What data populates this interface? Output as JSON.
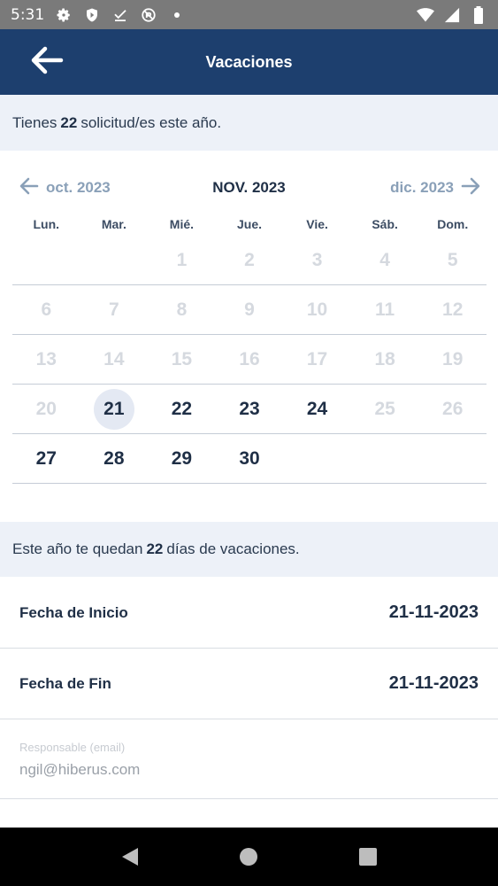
{
  "status_bar": {
    "time": "5:31",
    "icons_left": [
      "settings-icon",
      "shield-play-icon",
      "download-done-icon",
      "no-sim-icon",
      "dot-icon"
    ],
    "icons_right": [
      "wifi-icon",
      "signal-icon",
      "battery-icon"
    ]
  },
  "app_bar": {
    "title": "Vacaciones",
    "background": "#1d3f6e"
  },
  "requests_banner": {
    "prefix": "Tienes",
    "count": "22",
    "suffix": "solicitud/es este año."
  },
  "calendar": {
    "prev_month": "oct. 2023",
    "current_month": "NOV. 2023",
    "next_month": "dic. 2023",
    "weekdays": [
      "Lun.",
      "Mar.",
      "Mié.",
      "Jue.",
      "Vie.",
      "Sáb.",
      "Dom."
    ],
    "weeks": [
      [
        {
          "d": ""
        },
        {
          "d": ""
        },
        {
          "d": "1",
          "s": "disabled"
        },
        {
          "d": "2",
          "s": "disabled"
        },
        {
          "d": "3",
          "s": "disabled"
        },
        {
          "d": "4",
          "s": "disabled"
        },
        {
          "d": "5",
          "s": "disabled"
        }
      ],
      [
        {
          "d": "6",
          "s": "disabled"
        },
        {
          "d": "7",
          "s": "disabled"
        },
        {
          "d": "8",
          "s": "disabled"
        },
        {
          "d": "9",
          "s": "disabled"
        },
        {
          "d": "10",
          "s": "disabled"
        },
        {
          "d": "11",
          "s": "disabled"
        },
        {
          "d": "12",
          "s": "disabled"
        }
      ],
      [
        {
          "d": "13",
          "s": "disabled"
        },
        {
          "d": "14",
          "s": "disabled"
        },
        {
          "d": "15",
          "s": "disabled"
        },
        {
          "d": "16",
          "s": "disabled"
        },
        {
          "d": "17",
          "s": "disabled"
        },
        {
          "d": "18",
          "s": "disabled"
        },
        {
          "d": "19",
          "s": "disabled"
        }
      ],
      [
        {
          "d": "20",
          "s": "disabled"
        },
        {
          "d": "21",
          "s": "selected"
        },
        {
          "d": "22",
          "s": "enabled"
        },
        {
          "d": "23",
          "s": "enabled"
        },
        {
          "d": "24",
          "s": "enabled"
        },
        {
          "d": "25",
          "s": "disabled"
        },
        {
          "d": "26",
          "s": "disabled"
        }
      ],
      [
        {
          "d": "27",
          "s": "enabled"
        },
        {
          "d": "28",
          "s": "enabled"
        },
        {
          "d": "29",
          "s": "enabled"
        },
        {
          "d": "30",
          "s": "enabled"
        },
        {
          "d": ""
        },
        {
          "d": ""
        },
        {
          "d": ""
        }
      ]
    ]
  },
  "days_banner": {
    "prefix": "Este año te quedan",
    "count": "22",
    "suffix": "días de vacaciones."
  },
  "form": {
    "start_label": "Fecha de Inicio",
    "start_value": "21-11-2023",
    "end_label": "Fecha de Fin",
    "end_value": "21-11-2023",
    "email_label": "Responsable (email)",
    "email_value": "ngil@hiberus.com"
  },
  "nav_bar": {
    "buttons": [
      "back-triangle-icon",
      "home-circle-icon",
      "recents-square-icon"
    ]
  }
}
